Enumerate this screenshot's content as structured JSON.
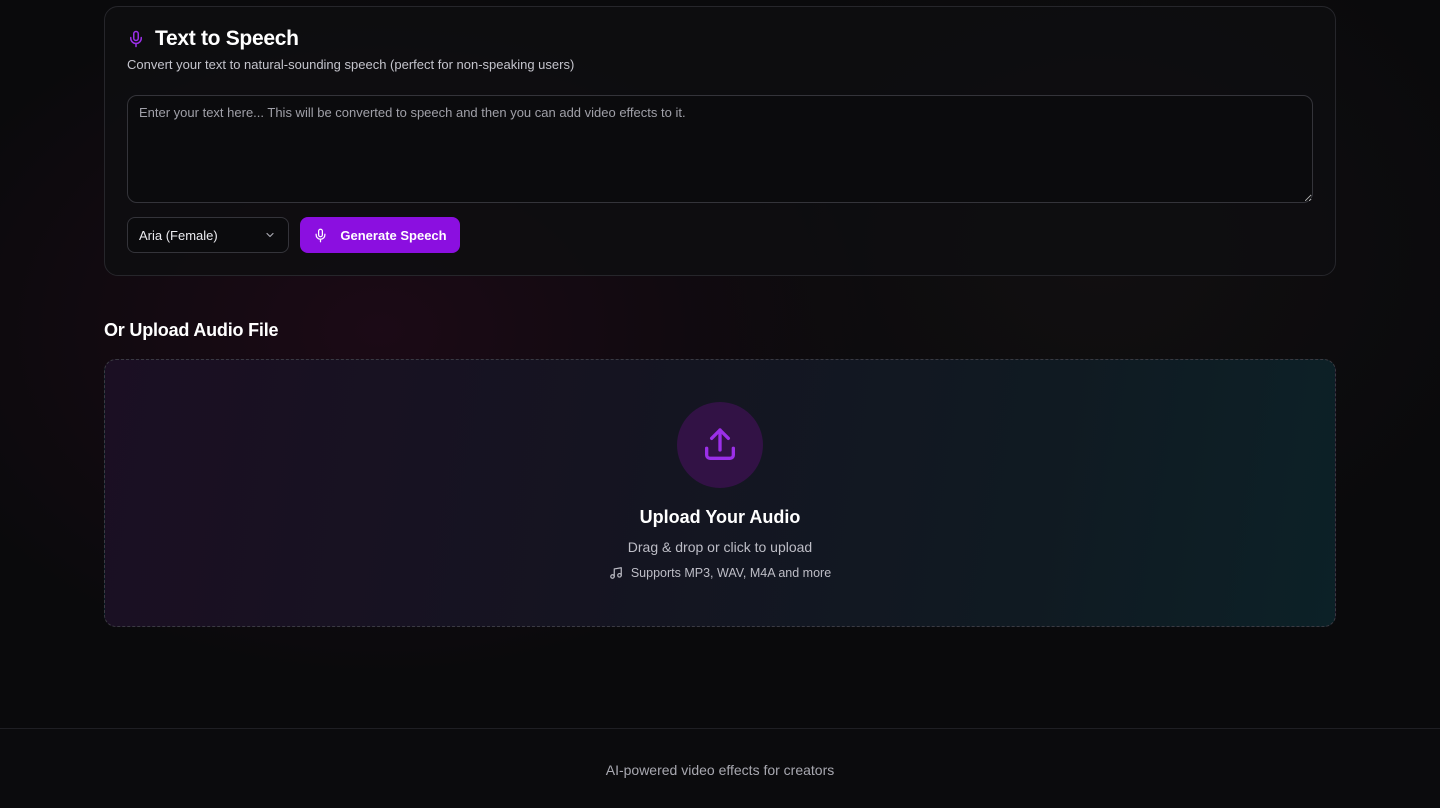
{
  "tts": {
    "title": "Text to Speech",
    "subtitle": "Convert your text to natural-sounding speech (perfect for non-speaking users)",
    "textarea_placeholder": "Enter your text here... This will be converted to speech and then you can add video effects to it.",
    "textarea_value": "",
    "voice_selected": "Aria (Female)",
    "generate_label": "Generate Speech",
    "icon": "mic-icon"
  },
  "upload": {
    "heading": "Or Upload Audio File",
    "title": "Upload Your Audio",
    "subtitle": "Drag & drop or click to upload",
    "formats": "Supports MP3, WAV, M4A and more",
    "icon": "upload-icon"
  },
  "footer": {
    "tagline": "AI-powered video effects for creators"
  },
  "colors": {
    "accent": "#8b0fe0",
    "accent_icon": "#9b2fe8",
    "background": "#0a0a0c"
  }
}
